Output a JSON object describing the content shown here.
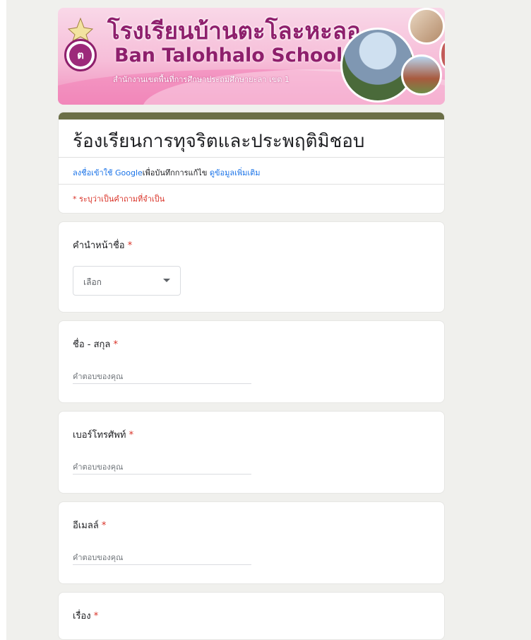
{
  "banner": {
    "school_thai": "โรงเรียนบ้านตะโละหะลอ",
    "school_english": "Ban Talohhalo School",
    "office": "สำนักงานเขตพื้นที่การศึกษาประถมศึกษายะลา เขต 1"
  },
  "form": {
    "title": "ร้องเรียนการทุจริตและประพฤติมิชอบ",
    "signin_link": "ลงชื่อเข้าใช้ Google",
    "signin_text": "เพื่อบันทึกการแก้ไข",
    "learn_more": "ดูข้อมูลเพิ่มเติม",
    "required_note": "* ระบุว่าเป็นคำถามที่จำเป็น"
  },
  "questions": [
    {
      "label": "คำนำหน้าชื่อ",
      "type": "dropdown",
      "value": "เลือก"
    },
    {
      "label": "ชื่อ - สกุล",
      "type": "text",
      "placeholder": "คำตอบของคุณ"
    },
    {
      "label": "เบอร์โทรศัพท์",
      "type": "text",
      "placeholder": "คำตอบของคุณ"
    },
    {
      "label": "อีเมลล์",
      "type": "text",
      "placeholder": "คำตอบของคุณ"
    },
    {
      "label": "เรื่อง",
      "type": "text"
    }
  ],
  "required_star": "*",
  "colors": {
    "accent": "#6b6f47",
    "link": "#1a73e8",
    "required": "#d93025",
    "background": "#f0f0ed"
  }
}
